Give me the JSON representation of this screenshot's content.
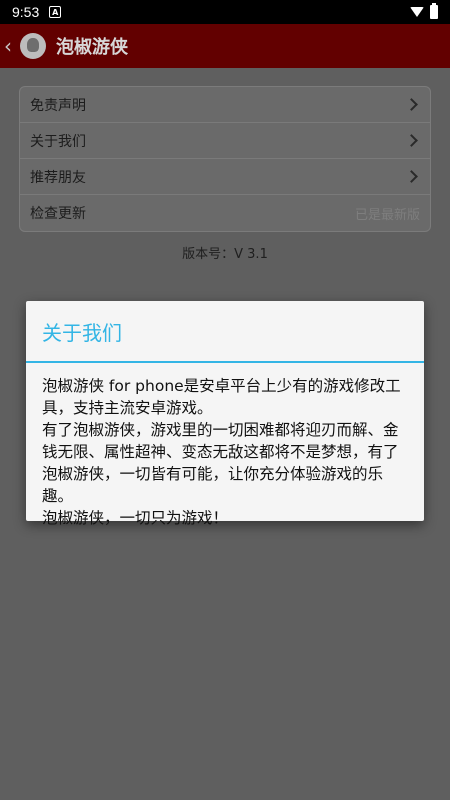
{
  "status_bar": {
    "time": "9:53",
    "notification_icon": "A",
    "icons": [
      "wifi-icon",
      "battery-icon"
    ]
  },
  "toolbar": {
    "title": "泡椒游侠"
  },
  "settings": {
    "items": [
      {
        "label": "免责声明",
        "has_chevron": true
      },
      {
        "label": "关于我们",
        "has_chevron": true
      },
      {
        "label": "推荐朋友",
        "has_chevron": true
      },
      {
        "label": "检查更新",
        "status": "已是最新版"
      }
    ]
  },
  "version_text": "版本号：V 3.1",
  "dialog": {
    "title": "关于我们",
    "paragraphs": [
      "泡椒游侠 for phone是安卓平台上少有的游戏修改工具，支持主流安卓游戏。",
      "有了泡椒游侠，游戏里的一切困难都将迎刃而解、金钱无限、属性超神、变态无敌这都将不是梦想，有了泡椒游侠，一切皆有可能，让你充分体验游戏的乐趣。",
      "泡椒游侠，一切只为游戏！"
    ]
  },
  "colors": {
    "toolbar": "#620000",
    "overlay_background": "#5f5f5f",
    "dialog_accent": "#33b5e5"
  }
}
